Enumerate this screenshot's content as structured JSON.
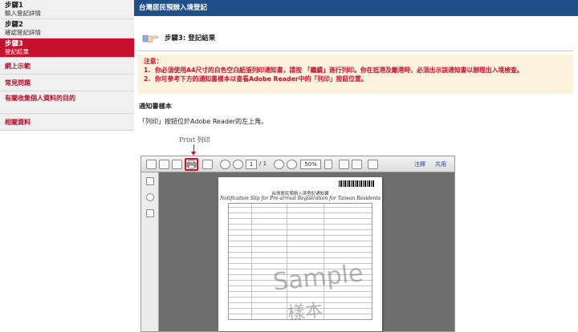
{
  "sidebar": {
    "steps": [
      {
        "title": "步驟1",
        "subtitle": "輸入登記詳情"
      },
      {
        "title": "步驟2",
        "subtitle": "確認登記詳情"
      },
      {
        "title": "步驟3",
        "subtitle": "登記結果"
      }
    ],
    "links": [
      "網上示範",
      "常見問題",
      "有關收集個人資料的目的",
      "相關資料"
    ]
  },
  "header": {
    "title": "台灣居民預辦入境登記"
  },
  "step_heading": "步驟3: 登記結果",
  "notice": {
    "label": "注意：",
    "items": [
      {
        "num": "1.",
        "text": "你必須使用A4尺寸的白色空白紙張列印通知書，請按 「繼續」進行列印。你在抵港及離港時，必須出示該通知書以辦理出入境檢查。"
      },
      {
        "num": "2.",
        "text": "你可參考下方的通知書樣本以查看Adobe Reader中的「列印」按鈕位置。"
      }
    ]
  },
  "section_title": "通知書樣本",
  "description": "「列印」按鈕位於Adobe Reader的左上角。",
  "sample": {
    "annotation": "Print  列印",
    "page_current": "1",
    "page_total": "/ 1",
    "zoom": "50%",
    "tool_label_1": "注釋",
    "tool_label_2": "共用",
    "doc_title": "台灣居民預辦入境登記通知書",
    "doc_subtitle": "Notification Slip for Pre-arrival Registration for Taiwan Residents",
    "watermark_en": "Sample",
    "watermark_zh": "樣本"
  }
}
